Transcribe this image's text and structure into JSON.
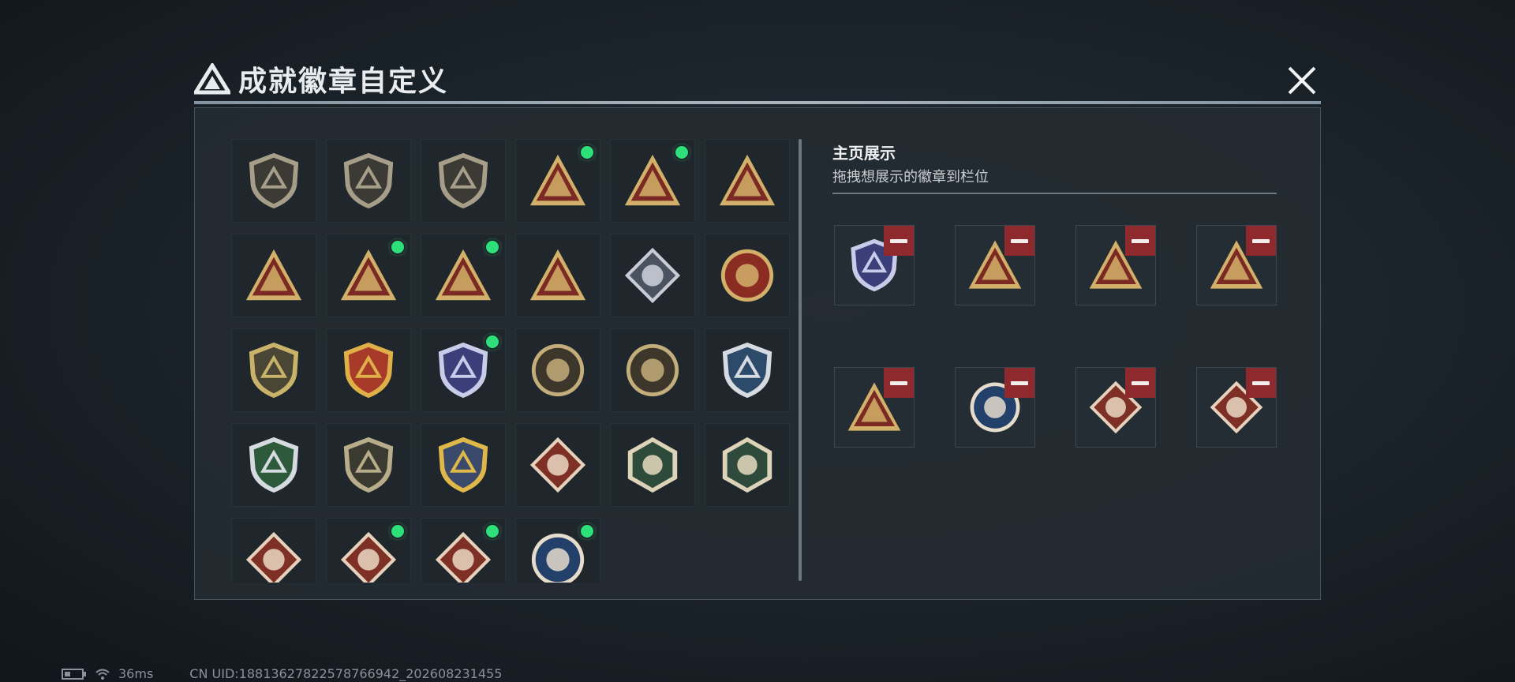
{
  "header": {
    "title": "成就徽章自定义",
    "logo_icon": "tri-logo-icon",
    "close_icon": "close-icon"
  },
  "colors": {
    "new_dot": "#2ee07a",
    "remove_button": "#8e2a2e",
    "panel_bg": "#242b32"
  },
  "collection": {
    "badges": [
      {
        "icon": "shield-logo-badge",
        "style": "shield",
        "fill": "#3b3a34",
        "accent": "#a79e8a",
        "new": false
      },
      {
        "icon": "helicopter-badge",
        "style": "shield",
        "fill": "#3b3a34",
        "accent": "#a79e8a",
        "new": false
      },
      {
        "icon": "dagger-badge",
        "style": "shield",
        "fill": "#3b3a34",
        "accent": "#a79e8a",
        "new": false
      },
      {
        "icon": "bag-55-badge",
        "style": "triangle",
        "fill": "#7a2a22",
        "accent": "#d3b06a",
        "new": true
      },
      {
        "icon": "armor-56-badge",
        "style": "triangle",
        "fill": "#7a2a22",
        "accent": "#d3b06a",
        "new": true
      },
      {
        "icon": "hand-sign-badge",
        "style": "triangle",
        "fill": "#7a2a22",
        "accent": "#d3b06a",
        "new": false
      },
      {
        "icon": "number-1-badge",
        "style": "triangle",
        "fill": "#7a2a22",
        "accent": "#d3b06a",
        "new": false
      },
      {
        "icon": "usb-badge",
        "style": "triangle",
        "fill": "#7a2a22",
        "accent": "#d3b06a",
        "new": true
      },
      {
        "icon": "crouching-figure-badge",
        "style": "triangle",
        "fill": "#7a2a22",
        "accent": "#d3b06a",
        "new": true
      },
      {
        "icon": "soldiers-badge",
        "style": "triangle",
        "fill": "#7a2a22",
        "accent": "#d3b06a",
        "new": false
      },
      {
        "icon": "rose-badge",
        "style": "diamond",
        "fill": "#4b5361",
        "accent": "#c9ccd6",
        "new": false
      },
      {
        "icon": "star-medal-badge",
        "style": "circle",
        "fill": "#8a2c22",
        "accent": "#d3b06a",
        "new": false
      },
      {
        "icon": "gold-crest-badge",
        "style": "shield",
        "fill": "#4a4636",
        "accent": "#c9b36a",
        "new": false
      },
      {
        "icon": "winged-shield-badge",
        "style": "shield",
        "fill": "#a83a2a",
        "accent": "#e0b048",
        "new": false
      },
      {
        "icon": "diamond-shield-badge",
        "style": "shield",
        "fill": "#3a3f7a",
        "accent": "#c8cce8",
        "new": true
      },
      {
        "icon": "agent-target-badge",
        "style": "circle",
        "fill": "#3d372b",
        "accent": "#c3ad7a",
        "new": false
      },
      {
        "icon": "skull-target-badge",
        "style": "circle",
        "fill": "#3d372b",
        "accent": "#c3ad7a",
        "new": false
      },
      {
        "icon": "sniper-blue-badge",
        "style": "shield",
        "fill": "#2c4a6a",
        "accent": "#d6dbe2",
        "new": false
      },
      {
        "icon": "sniper-green-badge",
        "style": "shield",
        "fill": "#2c5a3a",
        "accent": "#d6dbe2",
        "new": false
      },
      {
        "icon": "rifle-badge",
        "style": "shield",
        "fill": "#3a3a30",
        "accent": "#b8ad8a",
        "new": false
      },
      {
        "icon": "gold-emblem-badge",
        "style": "shield",
        "fill": "#3b4a6a",
        "accent": "#e0b84a",
        "new": false
      },
      {
        "icon": "wolf-badge",
        "style": "diamond",
        "fill": "#7e2f26",
        "accent": "#e6d2bc",
        "new": false
      },
      {
        "icon": "hornet-badge",
        "style": "hexagon",
        "fill": "#2e4a3a",
        "accent": "#dcd3b8",
        "new": false
      },
      {
        "icon": "hammer-badge",
        "style": "hexagon",
        "fill": "#2e4a3a",
        "accent": "#dcd3b8",
        "new": false
      },
      {
        "icon": "dragon-badge",
        "style": "diamond",
        "fill": "#7e2f26",
        "accent": "#e6d2bc",
        "new": false
      },
      {
        "icon": "dragon-badge",
        "style": "diamond",
        "fill": "#7e2f26",
        "accent": "#e6d2bc",
        "new": true
      },
      {
        "icon": "monkey-badge",
        "style": "diamond",
        "fill": "#7e2f26",
        "accent": "#e6d2bc",
        "new": true
      },
      {
        "icon": "lynx-badge",
        "style": "circle",
        "fill": "#23406a",
        "accent": "#e6dccb",
        "new": true
      }
    ]
  },
  "showcase": {
    "title": "主页展示",
    "subtitle": "拖拽想展示的徽章到栏位",
    "remove_icon": "minus-icon",
    "slots": [
      {
        "icon": "diamond-shield-badge",
        "style": "shield",
        "fill": "#3a3f7a",
        "accent": "#c8cce8"
      },
      {
        "icon": "bag-55-badge",
        "style": "triangle",
        "fill": "#7a2a22",
        "accent": "#d3b06a"
      },
      {
        "icon": "armor-56-badge",
        "style": "triangle",
        "fill": "#7a2a22",
        "accent": "#d3b06a"
      },
      {
        "icon": "usb-badge",
        "style": "triangle",
        "fill": "#7a2a22",
        "accent": "#d3b06a"
      },
      {
        "icon": "crouching-figure-badge",
        "style": "triangle",
        "fill": "#7a2a22",
        "accent": "#d3b06a"
      },
      {
        "icon": "lynx-badge",
        "style": "circle",
        "fill": "#23406a",
        "accent": "#e6dccb"
      },
      {
        "icon": "dragon-badge",
        "style": "diamond",
        "fill": "#7e2f26",
        "accent": "#e6d2bc"
      },
      {
        "icon": "monkey-badge",
        "style": "diamond",
        "fill": "#7e2f26",
        "accent": "#e6d2bc"
      }
    ]
  },
  "status_bar": {
    "battery_icon": "battery-icon",
    "wifi_icon": "wifi-icon",
    "ping": "36ms",
    "uid": "CN UID:18813627822578766942_202608231455"
  }
}
